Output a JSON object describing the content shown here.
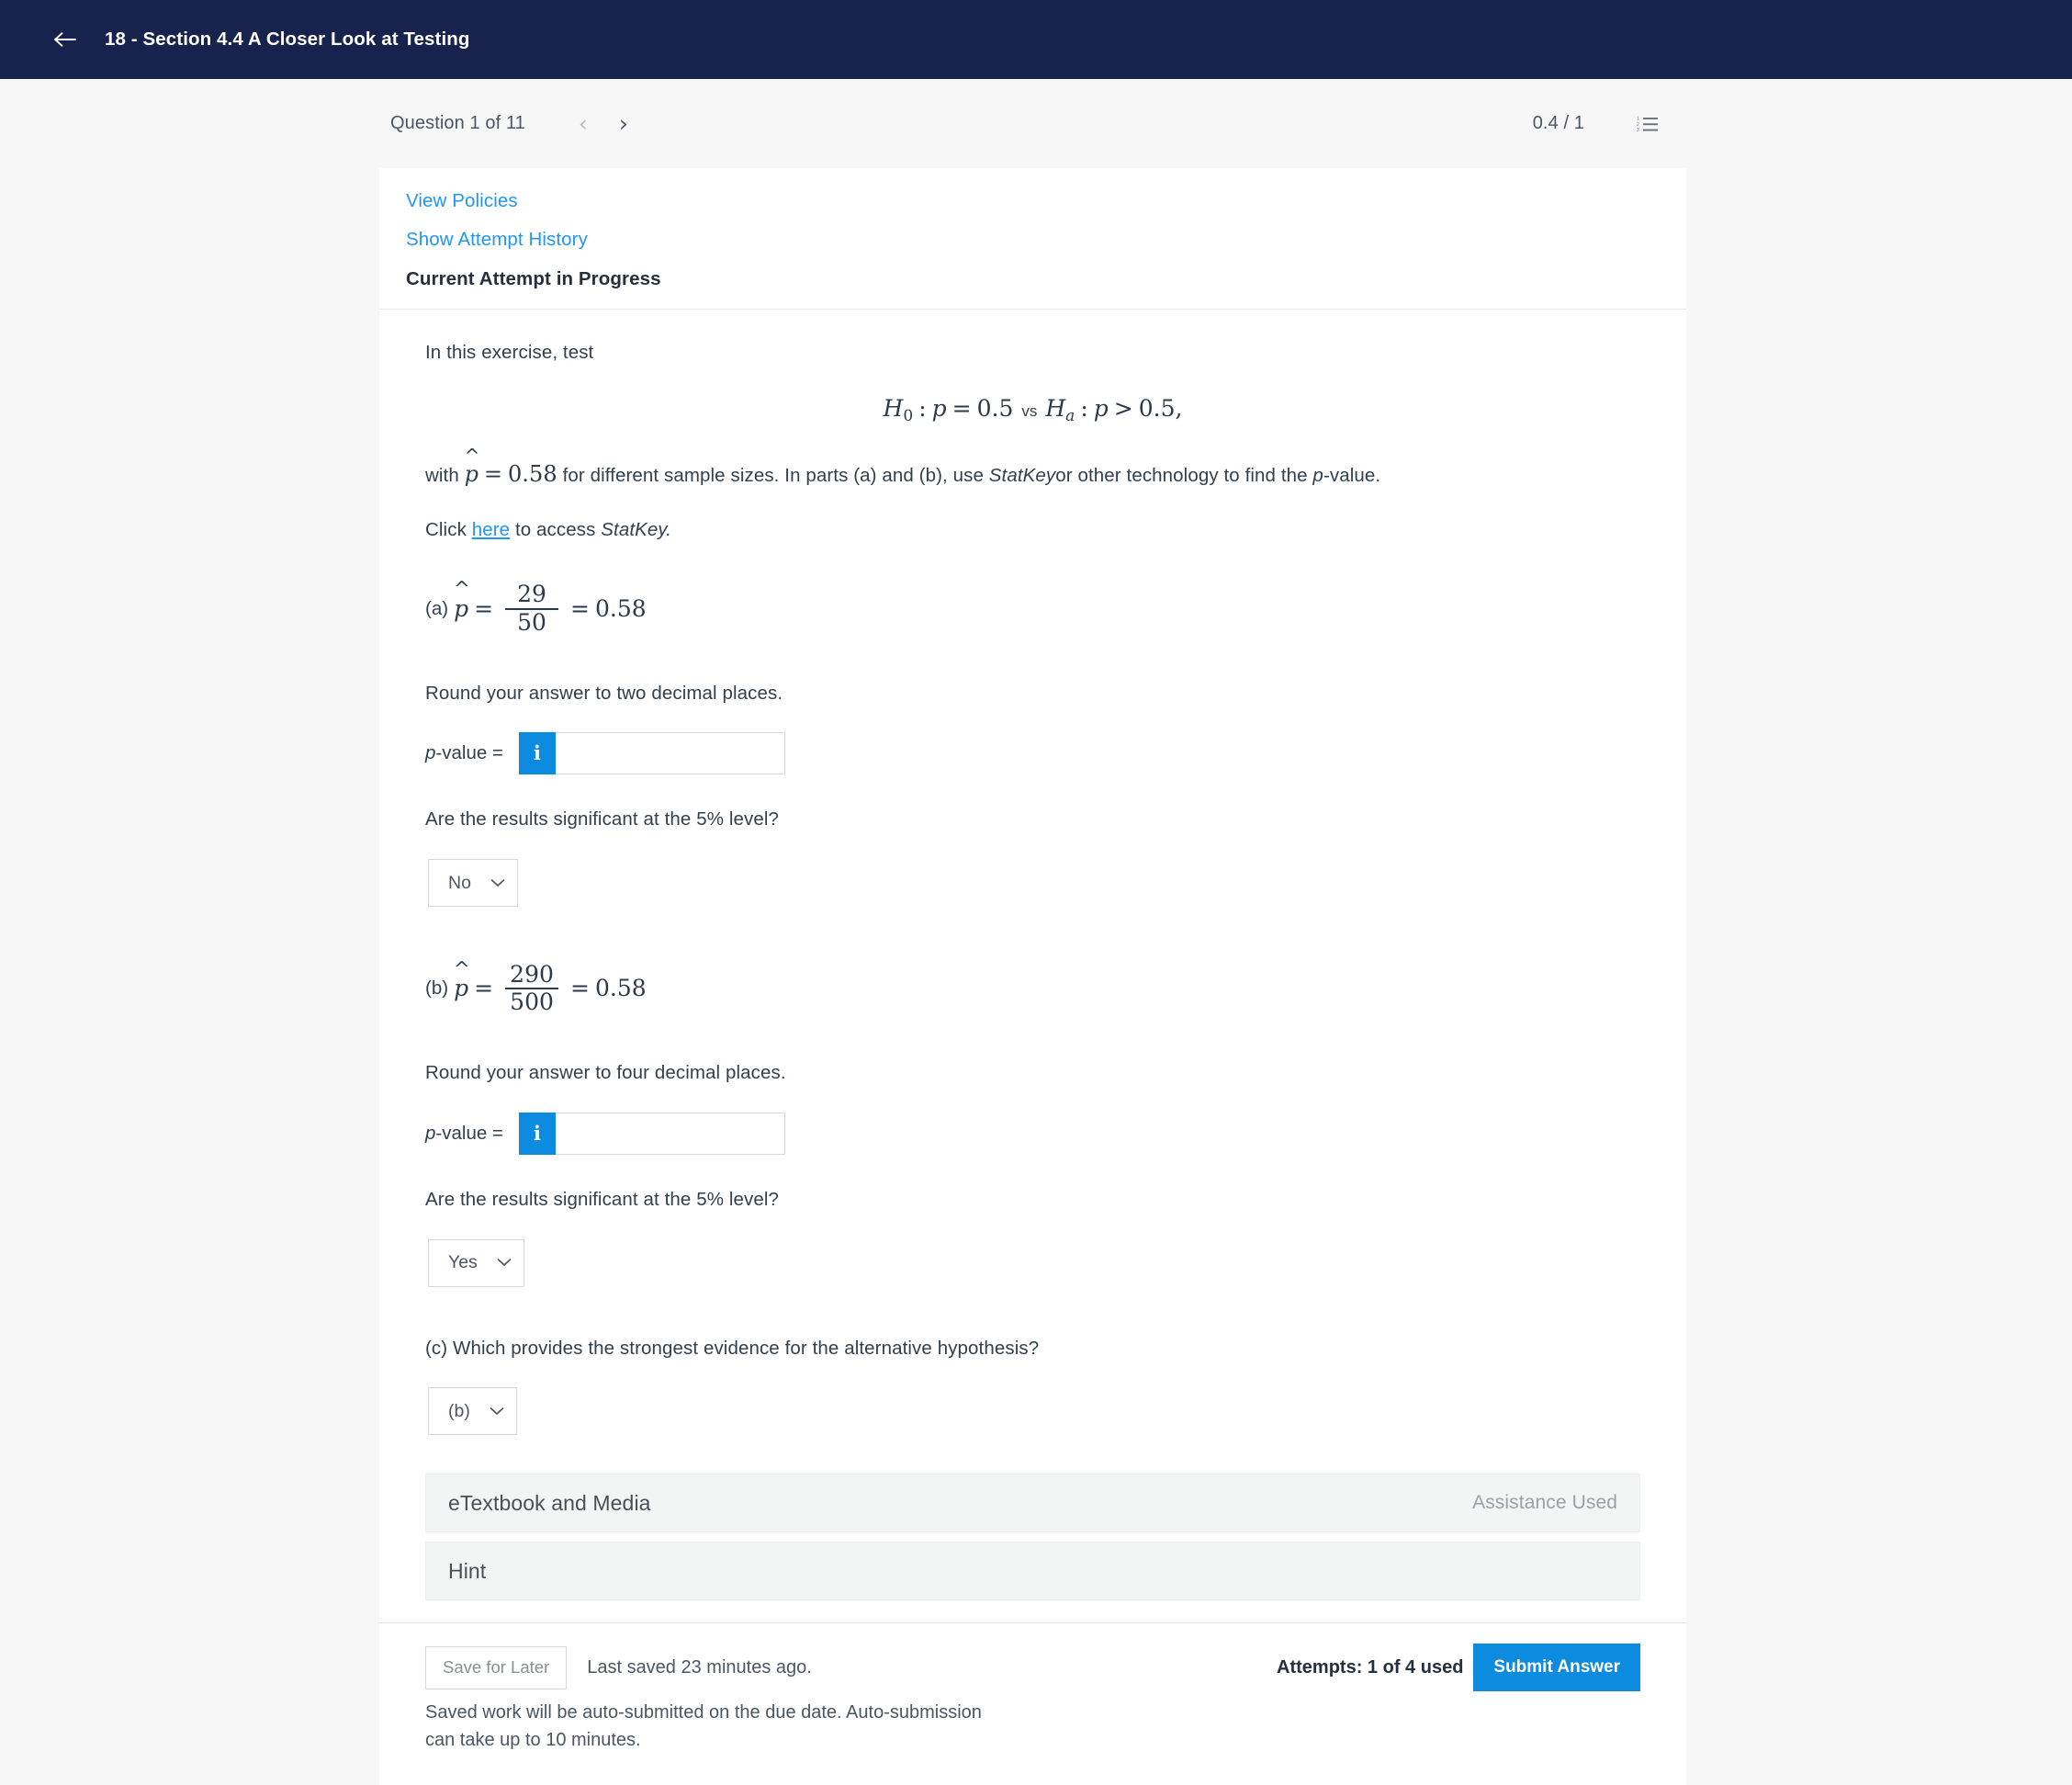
{
  "appbar": {
    "back_icon": "back-arrow-icon",
    "title": "18 - Section 4.4 A Closer Look at Testing"
  },
  "question_strip": {
    "question_label": "Question 1 of 11",
    "prev_icon": "‹",
    "next_icon": "›",
    "score": "0.4 / 1",
    "list_icon": "numbered-list-icon"
  },
  "card": {
    "links": [
      {
        "label": "View Policies"
      },
      {
        "label": "Show Attempt History"
      }
    ],
    "attempt_heading": "Current Attempt in Progress"
  },
  "question": {
    "intro": "In this exercise, test",
    "hypothesis": {
      "h0_symbol": "H",
      "h0_sub": "0",
      "colon": ":",
      "p": "p",
      "equals": "=",
      "null_value": "0.5",
      "vs": "vs",
      "ha_symbol": "H",
      "ha_sub": "a",
      "gt": ">",
      "alt_value": "0.5,"
    },
    "with_line": {
      "with": "with",
      "phat": "p",
      "equals": "=",
      "value": "0.58",
      "rest": "for different sample sizes. In parts (a) and (b), use",
      "statkey": "StatKey",
      "rest2": "or other technology to find the",
      "pvalue_italic": "p",
      "rest3": "-value."
    },
    "click_line": {
      "click": "Click",
      "link": "here",
      "to_access": "to access",
      "statkey": "StatKey."
    },
    "parts": [
      {
        "tag": "(a)",
        "phat": "p",
        "numerator": "29",
        "denominator": "50",
        "result": "0.58",
        "round_instruction": "Round your answer to two decimal places.",
        "pvalue_label_italic": "p",
        "pvalue_label_rest": "-value =",
        "info_icon": "info-icon",
        "info_glyph": "i",
        "input_value": "",
        "input_placeholder": "",
        "significance_question": "Are the results significant at the 5% level?",
        "select_value": "No",
        "caret": "⌄"
      },
      {
        "tag": "(b)",
        "phat": "p",
        "numerator": "290",
        "denominator": "500",
        "result": "0.58",
        "round_instruction": "Round your answer to four decimal places.",
        "pvalue_label_italic": "p",
        "pvalue_label_rest": "-value =",
        "info_icon": "info-icon",
        "info_glyph": "i",
        "input_value": "",
        "input_placeholder": "",
        "significance_question": "Are the results significant at the 5% level?",
        "select_value": "Yes",
        "caret": "⌄"
      }
    ],
    "part_c": {
      "question": "(c) Which provides the strongest evidence for the alternative hypothesis?",
      "select_value": "(b)",
      "caret": "⌄"
    }
  },
  "panels": [
    {
      "title": "eTextbook and Media",
      "right": "Assistance Used"
    },
    {
      "title": "Hint",
      "right": ""
    }
  ],
  "footer": {
    "save_for_later": "Save for Later",
    "last_saved": "Last saved 23 minutes ago.",
    "attempts": "Attempts: 1 of 4 used",
    "submit": "Submit Answer",
    "auto_note": "Saved work will be auto-submitted on the due date. Auto-submission can take up to 10 minutes."
  },
  "colors": {
    "appbar_navy": "#17234d",
    "link_blue": "#2196f3",
    "accent_blue": "#0d8bdf",
    "page_bg": "#f7f7f7",
    "panel_bg": "#f3f4f4",
    "text_dark": "#31404f"
  }
}
